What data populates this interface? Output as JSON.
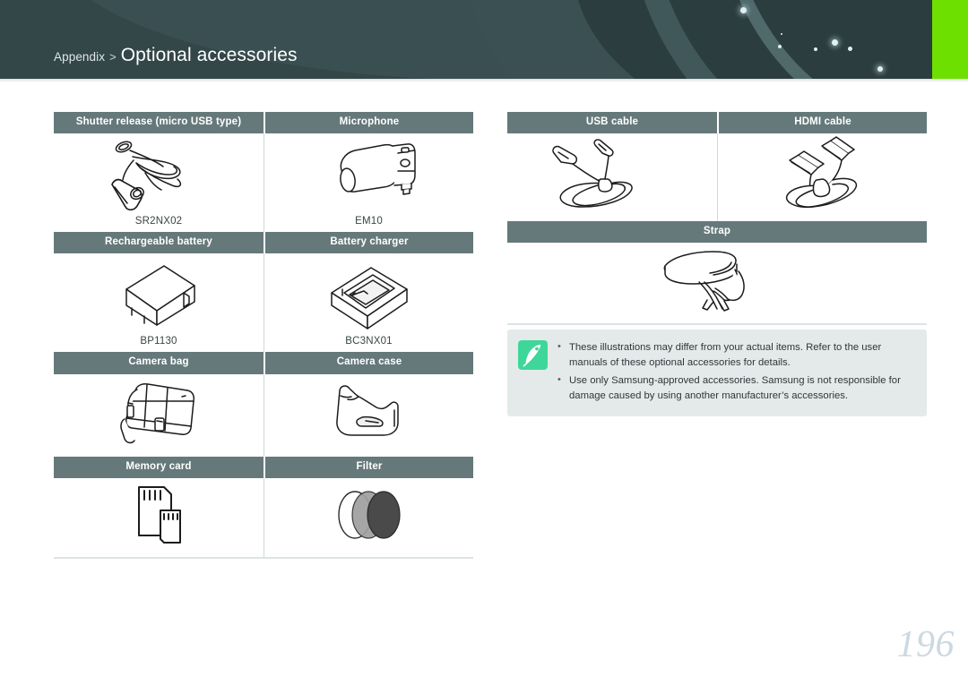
{
  "header": {
    "breadcrumb_parent": "Appendix",
    "breadcrumb_separator": ">",
    "title": "Optional accessories",
    "bg_color": "#334648",
    "accent_color": "#6ee000"
  },
  "tables": {
    "header_bg": "#66797a",
    "left": {
      "rows": [
        {
          "headers": [
            "Shutter release (micro USB type)",
            "Microphone"
          ],
          "cells": [
            {
              "icon": "shutter-release-cable-illustration",
              "model": "SR2NX02"
            },
            {
              "icon": "external-microphone-illustration",
              "model": "EM10"
            }
          ]
        },
        {
          "headers": [
            "Rechargeable battery",
            "Battery charger"
          ],
          "cells": [
            {
              "icon": "battery-pack-illustration",
              "model": "BP1130"
            },
            {
              "icon": "battery-charger-illustration",
              "model": "BC3NX01"
            }
          ]
        },
        {
          "headers": [
            "Camera bag",
            "Camera case"
          ],
          "cells": [
            {
              "icon": "camera-bag-illustration",
              "model": ""
            },
            {
              "icon": "camera-case-illustration",
              "model": ""
            }
          ]
        },
        {
          "headers": [
            "Memory card",
            "Filter"
          ],
          "cells": [
            {
              "icon": "memory-card-illustration",
              "model": ""
            },
            {
              "icon": "lens-filter-illustration",
              "model": ""
            }
          ]
        }
      ]
    },
    "right": {
      "rows": [
        {
          "headers": [
            "USB cable",
            "HDMI cable"
          ],
          "cells": [
            {
              "icon": "usb-cable-illustration",
              "model": ""
            },
            {
              "icon": "hdmi-cable-illustration",
              "model": ""
            }
          ]
        },
        {
          "headers": [
            "Strap"
          ],
          "cells": [
            {
              "icon": "camera-strap-illustration",
              "model": ""
            }
          ]
        }
      ]
    }
  },
  "note": {
    "icon": "note-pen-icon",
    "icon_bg": "#3fd69a",
    "bg_color": "#e4eaea",
    "items": [
      "These illustrations may differ from your actual items. Refer to the user manuals of these optional accessories for details.",
      "Use only Samsung-approved accessories. Samsung is not responsible for damage caused by using another manufacturer’s accessories."
    ]
  },
  "footer": {
    "page_number": "196"
  }
}
